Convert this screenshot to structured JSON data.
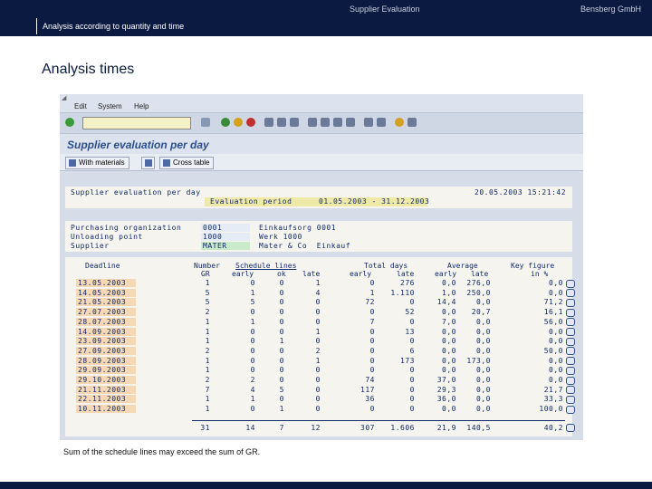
{
  "header": {
    "title": "Supplier Evaluation",
    "company": "Bensberg GmbH",
    "section": "Analysis according to quantity and time"
  },
  "page_title": "Analysis times",
  "sap": {
    "menu": [
      "Edit",
      "System",
      "Help"
    ],
    "title": "Supplier evaluation per day",
    "app_buttons": [
      "With materials",
      "Cross table"
    ],
    "report_header": "Supplier evaluation per day",
    "report_date": "20.05.2003 15:21:42",
    "evaluation_period_label": "Evaluation period",
    "evaluation_period_value": "01.05.2003 - 31.12.2003",
    "fields": [
      {
        "label": "Purchasing organization",
        "code": "0001",
        "text": "Einkaufsorg 0001"
      },
      {
        "label": "Unloading point",
        "code": "1000",
        "text": "Werk 1000"
      },
      {
        "label": "Supplier",
        "code": "MATER",
        "text": "Mater & Co  Einkauf"
      }
    ],
    "columns": {
      "deadline": "Deadline",
      "number": "Number",
      "gr": "GR",
      "schedule_lines": "Schedule lines",
      "early": "early",
      "ok": "ok",
      "late": "late",
      "total_days": "Total days",
      "td_early": "early",
      "td_late": "late",
      "average": "Average",
      "av_early": "early",
      "av_late": "late",
      "key_figure": "Key figure",
      "in_percent": "in %"
    },
    "rows": [
      {
        "deadline": "13.05.2003",
        "gr": "1",
        "early": "0",
        "ok": "0",
        "late": "1",
        "td_early": "0",
        "td_late": "276",
        "av_early": "0,0",
        "av_late": "276,0",
        "kf": "0,0"
      },
      {
        "deadline": "14.05.2003",
        "gr": "5",
        "early": "1",
        "ok": "0",
        "late": "4",
        "td_early": "1",
        "td_late": "1.110",
        "av_early": "1,0",
        "av_late": "250,0",
        "kf": "0,0"
      },
      {
        "deadline": "21.05.2003",
        "gr": "5",
        "early": "5",
        "ok": "0",
        "late": "0",
        "td_early": "72",
        "td_late": "0",
        "av_early": "14,4",
        "av_late": "0,0",
        "kf": "71,2"
      },
      {
        "deadline": "27.07.2003",
        "gr": "2",
        "early": "0",
        "ok": "0",
        "late": "0",
        "td_early": "0",
        "td_late": "52",
        "av_early": "0,0",
        "av_late": "20,7",
        "kf": "16,1"
      },
      {
        "deadline": "28.07.2003",
        "gr": "1",
        "early": "1",
        "ok": "0",
        "late": "0",
        "td_early": "7",
        "td_late": "0",
        "av_early": "7,0",
        "av_late": "0,0",
        "kf": "56,0"
      },
      {
        "deadline": "14.09.2003",
        "gr": "1",
        "early": "0",
        "ok": "0",
        "late": "1",
        "td_early": "0",
        "td_late": "13",
        "av_early": "0,0",
        "av_late": "0,0",
        "kf": "0,0"
      },
      {
        "deadline": "23.09.2003",
        "gr": "1",
        "early": "0",
        "ok": "1",
        "late": "0",
        "td_early": "0",
        "td_late": "0",
        "av_early": "0,0",
        "av_late": "0,0",
        "kf": "0,0"
      },
      {
        "deadline": "27.09.2003",
        "gr": "2",
        "early": "0",
        "ok": "0",
        "late": "2",
        "td_early": "0",
        "td_late": "6",
        "av_early": "0,0",
        "av_late": "0,0",
        "kf": "50,0"
      },
      {
        "deadline": "28.09.2003",
        "gr": "1",
        "early": "0",
        "ok": "0",
        "late": "1",
        "td_early": "0",
        "td_late": "173",
        "av_early": "0,0",
        "av_late": "173,0",
        "kf": "0,0"
      },
      {
        "deadline": "29.09.2003",
        "gr": "1",
        "early": "0",
        "ok": "0",
        "late": "0",
        "td_early": "0",
        "td_late": "0",
        "av_early": "0,0",
        "av_late": "0,0",
        "kf": "0,0"
      },
      {
        "deadline": "29.10.2003",
        "gr": "2",
        "early": "2",
        "ok": "0",
        "late": "0",
        "td_early": "74",
        "td_late": "0",
        "av_early": "37,0",
        "av_late": "0,0",
        "kf": "0,0"
      },
      {
        "deadline": "21.11.2003",
        "gr": "7",
        "early": "4",
        "ok": "5",
        "late": "0",
        "td_early": "117",
        "td_late": "0",
        "av_early": "29,3",
        "av_late": "0,0",
        "kf": "21,7"
      },
      {
        "deadline": "22.11.2003",
        "gr": "1",
        "early": "1",
        "ok": "0",
        "late": "0",
        "td_early": "36",
        "td_late": "0",
        "av_early": "36,0",
        "av_late": "0,0",
        "kf": "33,3"
      },
      {
        "deadline": "10.11.2003",
        "gr": "1",
        "early": "0",
        "ok": "1",
        "late": "0",
        "td_early": "0",
        "td_late": "0",
        "av_early": "0,0",
        "av_late": "0,0",
        "kf": "100,0"
      }
    ],
    "totals": {
      "gr": "31",
      "early": "14",
      "ok": "7",
      "late": "12",
      "td_early": "307",
      "td_late": "1.606",
      "av_early": "21,9",
      "av_late": "140,5",
      "kf": "40,2"
    }
  },
  "footnote": "Sum of the schedule lines may exceed the sum of GR.",
  "colors": {
    "brand": "#0a1a40",
    "deadline_bg": "#f6d9b4",
    "input_yellow": "#f3f0c6",
    "title_blue": "#2b4f8e"
  }
}
